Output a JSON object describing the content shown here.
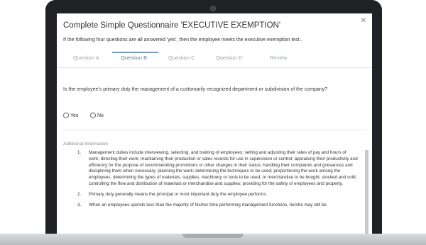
{
  "dialog": {
    "title": "Complete Simple Questionnaire 'EXECUTIVE EXEMPTION'",
    "close_icon": "close-icon",
    "subtitle": "If the following four questions are all answered 'yes', then the employee meets the executive exemption test.."
  },
  "tabs": [
    {
      "label": "Question A"
    },
    {
      "label": "Question B"
    },
    {
      "label": "Question C"
    },
    {
      "label": "Question D"
    },
    {
      "label": "Review"
    }
  ],
  "active_tab": "Question B",
  "question": {
    "text": "Is the employee's primary duty the management of a customarily recognized department or subdivision of the company?",
    "options": [
      "Yes",
      "No"
    ]
  },
  "additional_info": {
    "heading": "Additional Information",
    "items": [
      {
        "number": "1.",
        "text": "Management duties include interviewing, selecting, and training of employees; setting and adjusting their rates of pay and hours of work; directing their work; maintaining their production or sales records for use in supervision or control; appraising their productivity and efficiency for the purpose of recommending promotions or other changes in their status; handling their complaints and grievances and disciplining them when necessary; planning the work; determining the techniques to be used; proportioning the work among the employees; determining the types of materials, supplies, machinery or tools to be used, or merchandise to be bought, stocked and sold; controlling the flow and distribution of materials or merchandise and supplies; providing for the safety of employees and property."
      },
      {
        "number": "2.",
        "text": "Primary duty generally means the principal or most important duty the employee performs."
      },
      {
        "number": "3.",
        "text": "When an employees spends less than the majority of his/her time performing management functions, he/she may still be"
      }
    ]
  },
  "colors": {
    "active_tab": "#5d7ea0",
    "tab_underline": "#7d9bbf",
    "inactive_tab": "#9aa3ad",
    "laptop_bezel": "#1f2125"
  }
}
